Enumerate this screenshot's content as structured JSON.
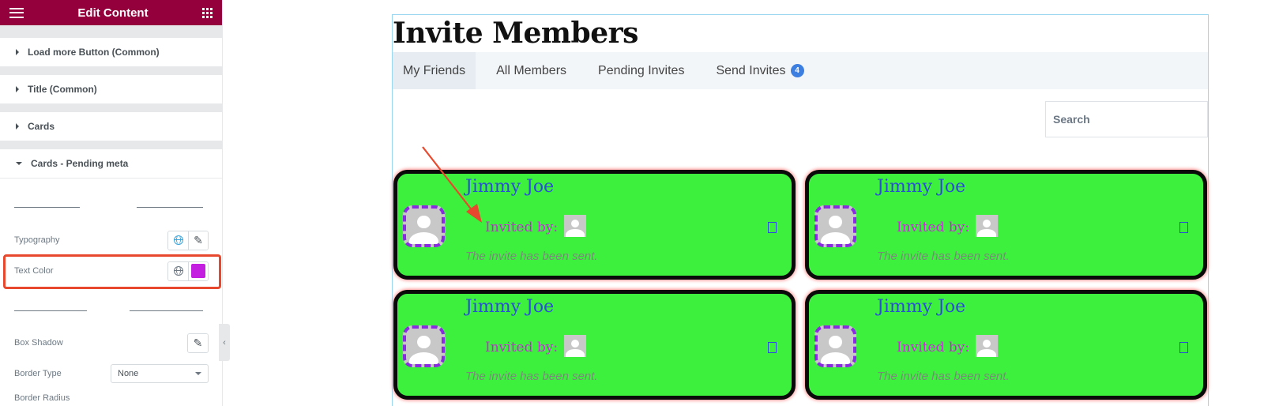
{
  "panel": {
    "title": "Edit Content",
    "sections": [
      {
        "label": "Load more Button (Common)",
        "expanded": false
      },
      {
        "label": "Title (Common)",
        "expanded": false
      },
      {
        "label": "Cards",
        "expanded": false
      },
      {
        "label": "Cards - Pending meta",
        "expanded": true
      }
    ],
    "controls": {
      "typography_label": "Typography",
      "text_color_label": "Text Color",
      "text_color_value": "#c41fe0",
      "box_shadow_label": "Box Shadow",
      "border_type_label": "Border Type",
      "border_type_value": "None",
      "border_radius_label": "Border Radius"
    }
  },
  "preview": {
    "title": "Invite Members",
    "tabs": [
      {
        "label": "My Friends",
        "active": true
      },
      {
        "label": "All Members",
        "active": false
      },
      {
        "label": "Pending Invites",
        "active": false
      },
      {
        "label": "Send Invites",
        "active": false,
        "badge": "4"
      }
    ],
    "search_placeholder": "Search",
    "cards": [
      {
        "name": "Jimmy Joe",
        "invited_by": "Invited by:",
        "status": "The invite has been sent."
      },
      {
        "name": "Jimmy Joe",
        "invited_by": "Invited by:",
        "status": "The invite has been sent."
      },
      {
        "name": "Jimmy Joe",
        "invited_by": "Invited by:",
        "status": "The invite has been sent."
      },
      {
        "name": "Jimmy Joe",
        "invited_by": "Invited by:",
        "status": "The invite has been sent."
      }
    ]
  },
  "colors": {
    "brand": "#93003c",
    "card_bg": "#3ef03e",
    "annotation": "#e8482d"
  }
}
